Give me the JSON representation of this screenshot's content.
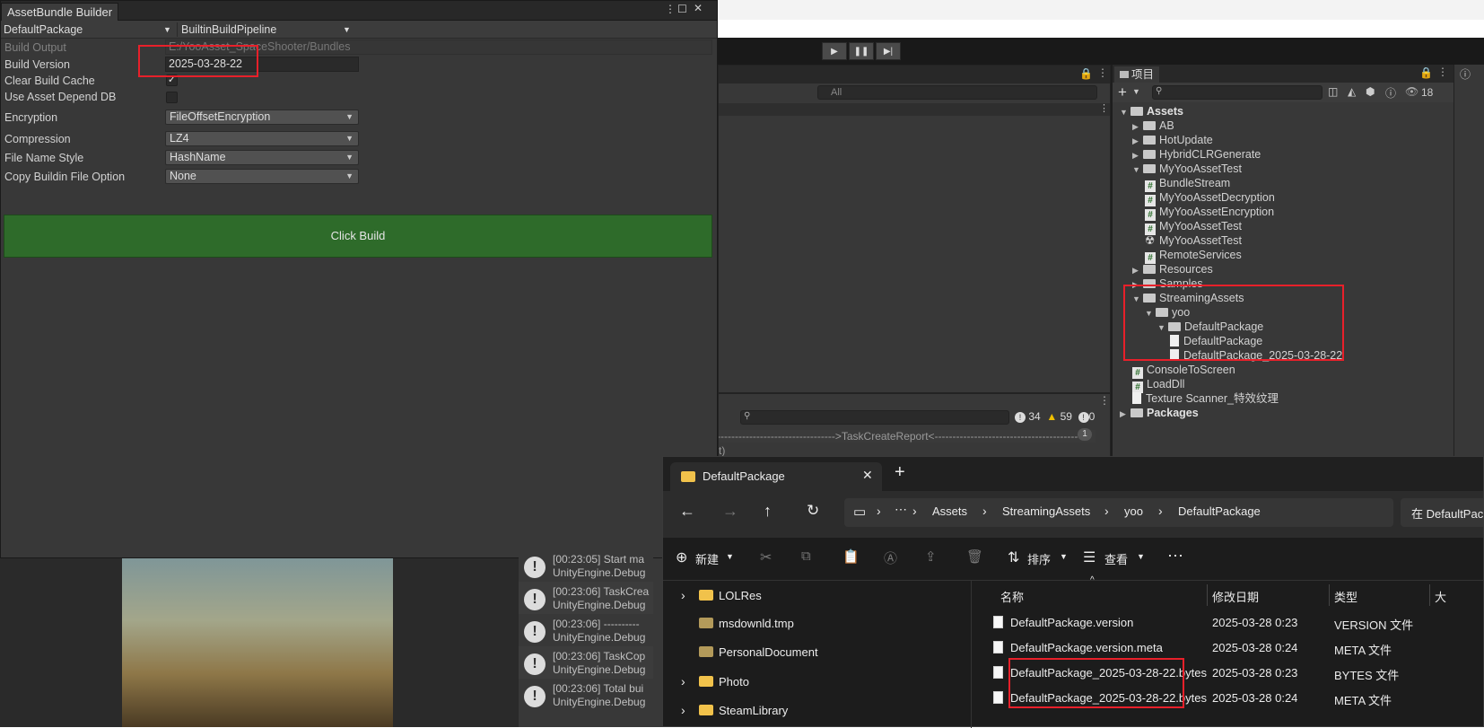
{
  "asset_bundle": {
    "title": "AssetBundle Builder",
    "package": "DefaultPackage",
    "pipeline": "BuiltinBuildPipeline",
    "build_output_label": "Build Output",
    "build_output_value": "E:/YooAsset_SpaceShooter/Bundles",
    "build_version_label": "Build Version",
    "build_version_value": "2025-03-28-22",
    "clear_cache_label": "Clear Build Cache",
    "use_depend_label": "Use Asset Depend DB",
    "encryption_label": "Encryption",
    "encryption_value": "FileOffsetEncryption",
    "compression_label": "Compression",
    "compression_value": "LZ4",
    "file_name_label": "File Name Style",
    "file_name_value": "HashName",
    "copy_label": "Copy Buildin File Option",
    "copy_value": "None",
    "build_button": "Click Build"
  },
  "scene_search_placeholder": "All",
  "project": {
    "tab": "项目",
    "count": "18",
    "tree": [
      {
        "label": "Assets",
        "type": "folder",
        "bold": true
      },
      {
        "label": "AB",
        "type": "folder"
      },
      {
        "label": "HotUpdate",
        "type": "folder"
      },
      {
        "label": "HybridCLRGenerate",
        "type": "folder"
      },
      {
        "label": "MyYooAssetTest",
        "type": "folder"
      },
      {
        "label": "BundleStream",
        "type": "script"
      },
      {
        "label": "MyYooAssetDecryption",
        "type": "script"
      },
      {
        "label": "MyYooAssetEncryption",
        "type": "script"
      },
      {
        "label": "MyYooAssetTest",
        "type": "script"
      },
      {
        "label": "MyYooAssetTest",
        "type": "scene"
      },
      {
        "label": "RemoteServices",
        "type": "script"
      },
      {
        "label": "Resources",
        "type": "folder"
      },
      {
        "label": "Samples",
        "type": "folder"
      },
      {
        "label": "StreamingAssets",
        "type": "folder"
      },
      {
        "label": "yoo",
        "type": "folder"
      },
      {
        "label": "DefaultPackage",
        "type": "folder"
      },
      {
        "label": "DefaultPackage",
        "type": "file"
      },
      {
        "label": "DefaultPackage_2025-03-28-22",
        "type": "file"
      },
      {
        "label": "ConsoleToScreen",
        "type": "script"
      },
      {
        "label": "LoadDll",
        "type": "script"
      },
      {
        "label": "Texture Scanner_特效纹理",
        "type": "file"
      },
      {
        "label": "Packages",
        "type": "folder",
        "bold": true
      }
    ]
  },
  "console": {
    "log_line": "---------------------------------------->TaskCreateReport<------------------------------------------",
    "log_line2": "t)",
    "badge": "1",
    "info_count": "34",
    "warn_count": "59",
    "err_count": "0",
    "entries": [
      {
        "line1": "[00:23:05] Start ma",
        "line2": "UnityEngine.Debug"
      },
      {
        "line1": "[00:23:06] TaskCrea",
        "line2": "UnityEngine.Debug"
      },
      {
        "line1": "[00:23:06] ----------",
        "line2": "UnityEngine.Debug"
      },
      {
        "line1": "[00:23:06] TaskCop",
        "line2": "UnityEngine.Debug"
      },
      {
        "line1": "[00:23:06] Total bui",
        "line2": "UnityEngine.Debug"
      }
    ]
  },
  "explorer": {
    "tab_title": "DefaultPackage",
    "breadcrumb": [
      "Assets",
      "StreamingAssets",
      "yoo",
      "DefaultPackage"
    ],
    "search_placeholder": "在 DefaultPac",
    "new_label": "新建",
    "sort_label": "排序",
    "view_label": "查看",
    "sidebar": [
      {
        "label": "LOLRes",
        "expandable": true
      },
      {
        "label": "msdownld.tmp",
        "expandable": false
      },
      {
        "label": "PersonalDocument",
        "expandable": false
      },
      {
        "label": "Photo",
        "expandable": true
      },
      {
        "label": "SteamLibrary",
        "expandable": true
      }
    ],
    "columns": [
      "名称",
      "修改日期",
      "类型",
      "大"
    ],
    "files": [
      {
        "name": "DefaultPackage.version",
        "date": "2025-03-28 0:23",
        "type": "VERSION 文件"
      },
      {
        "name": "DefaultPackage.version.meta",
        "date": "2025-03-28 0:24",
        "type": "META 文件"
      },
      {
        "name": "DefaultPackage_2025-03-28-22.bytes",
        "date": "2025-03-28 0:23",
        "type": "BYTES 文件"
      },
      {
        "name": "DefaultPackage_2025-03-28-22.bytes....",
        "date": "2025-03-28 0:24",
        "type": "META 文件"
      }
    ]
  }
}
